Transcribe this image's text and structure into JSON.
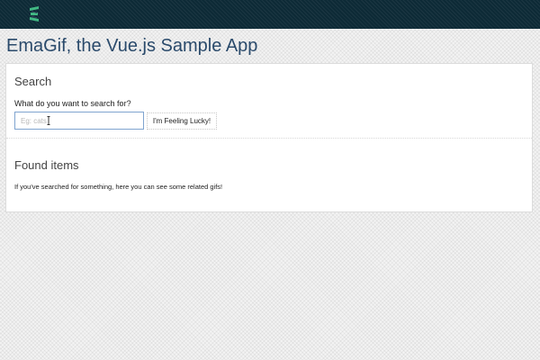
{
  "header": {
    "logo_icon": "vue-logo-icon",
    "colors": {
      "background": "#0d2a36",
      "logo_green": "#41b883",
      "logo_dark": "#35495e"
    }
  },
  "page": {
    "title": "EmaGif, the Vue.js Sample App",
    "title_color": "#2a4a6b"
  },
  "search": {
    "heading": "Search",
    "label": "What do you want to search for?",
    "input_value": "",
    "placeholder": "Eg: cats",
    "button_label": "I'm Feeling Lucky!"
  },
  "results": {
    "heading": "Found items",
    "description": "If you've searched for something, here you can see some related gifs!"
  }
}
